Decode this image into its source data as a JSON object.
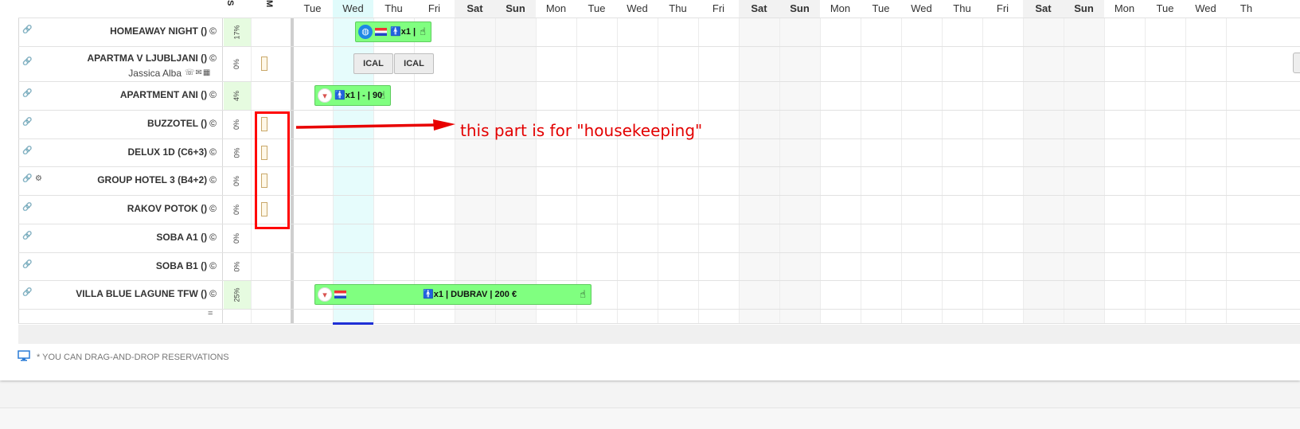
{
  "days": [
    {
      "label": "Tue",
      "weekend": false,
      "today": false
    },
    {
      "label": "Wed",
      "weekend": false,
      "today": true
    },
    {
      "label": "Thu",
      "weekend": false,
      "today": false
    },
    {
      "label": "Fri",
      "weekend": false,
      "today": false
    },
    {
      "label": "Sat",
      "weekend": true,
      "today": false
    },
    {
      "label": "Sun",
      "weekend": true,
      "today": false
    },
    {
      "label": "Mon",
      "weekend": false,
      "today": false
    },
    {
      "label": "Tue",
      "weekend": false,
      "today": false
    },
    {
      "label": "Wed",
      "weekend": false,
      "today": false
    },
    {
      "label": "Thu",
      "weekend": false,
      "today": false
    },
    {
      "label": "Fri",
      "weekend": false,
      "today": false
    },
    {
      "label": "Sat",
      "weekend": true,
      "today": false
    },
    {
      "label": "Sun",
      "weekend": true,
      "today": false
    },
    {
      "label": "Mon",
      "weekend": false,
      "today": false
    },
    {
      "label": "Tue",
      "weekend": false,
      "today": false
    },
    {
      "label": "Wed",
      "weekend": false,
      "today": false
    },
    {
      "label": "Thu",
      "weekend": false,
      "today": false
    },
    {
      "label": "Fri",
      "weekend": false,
      "today": false
    },
    {
      "label": "Sat",
      "weekend": true,
      "today": false
    },
    {
      "label": "Sun",
      "weekend": true,
      "today": false
    },
    {
      "label": "Mon",
      "weekend": false,
      "today": false
    },
    {
      "label": "Tue",
      "weekend": false,
      "today": false
    },
    {
      "label": "Wed",
      "weekend": false,
      "today": false
    },
    {
      "label": "Th",
      "weekend": false,
      "today": false
    }
  ],
  "columns": {
    "s_label": "S",
    "m_label": "M"
  },
  "rooms": [
    {
      "name": "HOMEAWAY NIGHT ()",
      "occupancy": "17%",
      "highlight": true,
      "guest": null,
      "extra_icon": false,
      "hk": false
    },
    {
      "name": "APARTMA V LJUBLJANI ()",
      "occupancy": "0%",
      "highlight": false,
      "guest": "Jassica Alba",
      "extra_icon": false,
      "hk": true
    },
    {
      "name": "APARTMENT ANI ()",
      "occupancy": "4%",
      "highlight": true,
      "guest": null,
      "extra_icon": false,
      "hk": false
    },
    {
      "name": "BUZZOTEL ()",
      "occupancy": "0%",
      "highlight": false,
      "guest": null,
      "extra_icon": false,
      "hk": true
    },
    {
      "name": "DELUX 1D (C6+3)",
      "occupancy": "0%",
      "highlight": false,
      "guest": null,
      "extra_icon": false,
      "hk": true
    },
    {
      "name": "GROUP HOTEL 3 (B4+2)",
      "occupancy": "0%",
      "highlight": false,
      "guest": null,
      "extra_icon": true,
      "hk": true
    },
    {
      "name": "RAKOV POTOK ()",
      "occupancy": "0%",
      "highlight": false,
      "guest": null,
      "extra_icon": false,
      "hk": true
    },
    {
      "name": "SOBA A1 ()",
      "occupancy": "0%",
      "highlight": false,
      "guest": null,
      "extra_icon": false,
      "hk": false
    },
    {
      "name": "SOBA B1 ()",
      "occupancy": "0%",
      "highlight": false,
      "guest": null,
      "extra_icon": false,
      "hk": false
    },
    {
      "name": "VILLA BLUE LAGUNE TFW ()",
      "occupancy": "25%",
      "highlight": true,
      "guest": null,
      "extra_icon": false,
      "hk": false
    }
  ],
  "copyright_symbol": "©",
  "link_symbol": "🔗",
  "reservations": [
    {
      "row": 0,
      "start_day": 1,
      "span_days": 2,
      "text": "🚹x1 |",
      "badge": "globe-icon",
      "flag": true
    },
    {
      "row": 2,
      "start_day": 0,
      "span_days": 2,
      "text": "🚹x1 | - | 90",
      "badge": "brand-icon",
      "flag": false
    },
    {
      "row": 9,
      "start_day": 0,
      "span_days": 7,
      "text": "🚹x1 | DUBRAV | 200 €",
      "badge": "brand-icon",
      "flag": true
    }
  ],
  "ical_buttons": [
    {
      "label": "ICAL",
      "day": 1
    },
    {
      "label": "ICAL",
      "day": 2
    }
  ],
  "footer_note": "* YOU CAN DRAG-AND-DROP RESERVATIONS",
  "eq_mark": "=",
  "annotation": {
    "text": "this part is for \"housekeeping\"",
    "color": "#ff0000"
  }
}
